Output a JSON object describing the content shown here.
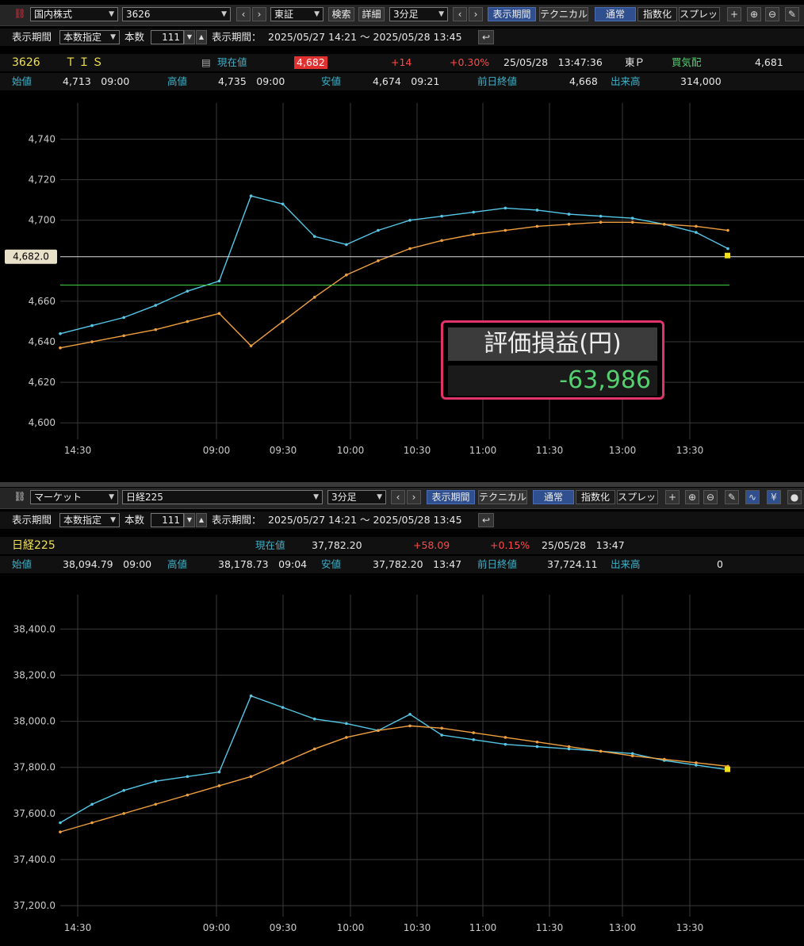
{
  "top": {
    "toolbar": {
      "market_select": "国内株式",
      "code_input": "3626",
      "exchange_select": "東証",
      "search_button": "検索",
      "detail_button": "詳細",
      "interval_select": "3分足",
      "display_period_button": "表示期間",
      "technical_button": "テクニカル",
      "normal_button": "通常",
      "index_button": "指数化",
      "spread_button": "スプレッド"
    },
    "period_row": {
      "period_label": "表示期間",
      "period_select": "本数指定",
      "count_label": "本数",
      "count_value": "111",
      "range_label": "表示期間：",
      "range_value": "2025/05/27 14:21 ～ 2025/05/28 13:45"
    },
    "quote_row": {
      "code": "3626",
      "name": "ＴＩＳ",
      "current_label": "現在値",
      "current_value": "4,682",
      "change": "+14",
      "change_pct": "+0.30%",
      "datetime": "25/05/28　13:47:36",
      "market": "東Ｐ",
      "bid_label": "買気配",
      "bid_value": "4,681"
    },
    "ohlc_row": {
      "open_label": "始値",
      "open_value": "4,713　09:00",
      "high_label": "高値",
      "high_value": "4,735　09:00",
      "low_label": "安値",
      "low_value": "4,674　09:21",
      "prev_label": "前日終値",
      "prev_value": "4,668",
      "volume_label": "出来高",
      "volume_value": "314,000"
    },
    "chart_data": {
      "type": "line",
      "y_ticks": [
        "4,740",
        "4,720",
        "4,700",
        "4,660",
        "4,640",
        "4,620",
        "4,600"
      ],
      "x_ticks": [
        "14:30",
        "09:00",
        "09:30",
        "10:00",
        "10:30",
        "11:00",
        "11:30",
        "13:00",
        "13:30"
      ],
      "ylim": [
        4595,
        4750
      ],
      "current_price_label": "4,682.0",
      "current_price": 4682,
      "series": [
        {
          "values": [
            4644,
            4648,
            4652,
            4658,
            4665,
            4670,
            4712,
            4708,
            4692,
            4688,
            4695,
            4700,
            4702,
            4704,
            4706,
            4705,
            4703,
            4702,
            4701,
            4698,
            4694,
            4686
          ]
        },
        {
          "values": [
            4637,
            4640,
            4643,
            4646,
            4650,
            4654,
            4638,
            4650,
            4662,
            4673,
            4680,
            4686,
            4690,
            4693,
            4695,
            4697,
            4698,
            4699,
            4699,
            4698,
            4697,
            4695
          ]
        }
      ],
      "panel_title": "評価損益(円)",
      "panel_value": "-63,986"
    }
  },
  "bottom": {
    "toolbar": {
      "market_select": "マーケット",
      "index_select": "日経225",
      "interval_select": "3分足",
      "display_period_button": "表示期間",
      "technical_button": "テクニカル",
      "normal_button": "通常",
      "index_button": "指数化",
      "spread_button": "スプレッド"
    },
    "period_row": {
      "period_label": "表示期間",
      "period_select": "本数指定",
      "count_label": "本数",
      "count_value": "111",
      "range_label": "表示期間：",
      "range_value": "2025/05/27 14:21 ～ 2025/05/28 13:45"
    },
    "quote_row": {
      "name": "日経225",
      "current_label": "現在値",
      "current_value": "37,782.20",
      "change": "+58.09",
      "change_pct": "+0.15%",
      "datetime": "25/05/28　13:47"
    },
    "ohlc_row": {
      "open_label": "始値",
      "open_value": "38,094.79　09:00",
      "high_label": "高値",
      "high_value": "38,178.73　09:04",
      "low_label": "安値",
      "low_value": "37,782.20　13:47",
      "prev_label": "前日終値",
      "prev_value": "37,724.11",
      "volume_label": "出来高",
      "volume_value": "0"
    },
    "chart_data": {
      "type": "line",
      "y_ticks": [
        "38,400.0",
        "38,200.0",
        "38,000.0",
        "37,800.0",
        "37,600.0",
        "37,400.0",
        "37,200.0"
      ],
      "x_ticks": [
        "14:30",
        "09:00",
        "09:30",
        "10:00",
        "10:30",
        "11:00",
        "11:30",
        "13:00",
        "13:30"
      ],
      "ylim": [
        37180,
        38480
      ],
      "series": [
        {
          "values": [
            37560,
            37640,
            37700,
            37740,
            37760,
            37780,
            38110,
            38060,
            38010,
            37990,
            37960,
            38030,
            37940,
            37920,
            37900,
            37890,
            37880,
            37870,
            37860,
            37830,
            37810,
            37790
          ]
        },
        {
          "values": [
            37520,
            37560,
            37600,
            37640,
            37680,
            37720,
            37760,
            37820,
            37880,
            37930,
            37960,
            37980,
            37970,
            37950,
            37930,
            37910,
            37890,
            37870,
            37850,
            37835,
            37820,
            37805
          ]
        }
      ]
    }
  },
  "colors": {
    "price_line": "#55c8e8",
    "avg_line": "#f0a040",
    "green_line": "#40d040",
    "bands": "#6060e0"
  }
}
